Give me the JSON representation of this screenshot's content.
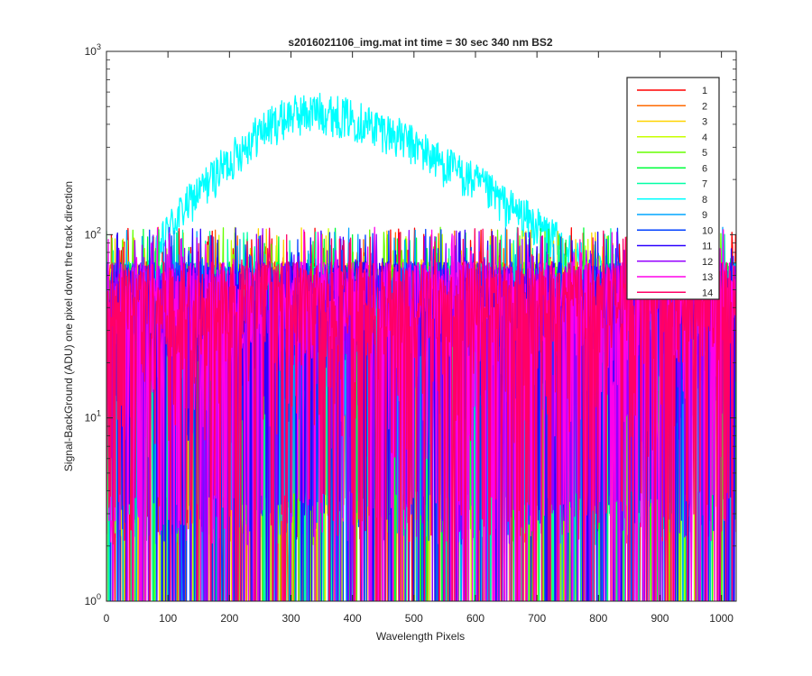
{
  "chart_data": {
    "type": "line",
    "title": "s2016021106_img.mat int time = 30 sec  340 nm BS2",
    "xlabel": "Wavelength Pixels",
    "ylabel": "Signal-BackGround (ADU) one pixel down the track direction",
    "xlim": [
      0,
      1024
    ],
    "ylim": [
      1,
      1000
    ],
    "yscale": "log",
    "grid": false,
    "legend_position": "top-right",
    "x_ticks": [
      "0",
      "100",
      "200",
      "300",
      "400",
      "500",
      "600",
      "700",
      "800",
      "900",
      "1000"
    ],
    "y_ticks": [
      {
        "base": "10",
        "exp": "0"
      },
      {
        "base": "10",
        "exp": "1"
      },
      {
        "base": "10",
        "exp": "2"
      },
      {
        "base": "10",
        "exp": "3"
      }
    ],
    "noise_band": {
      "typical_range_adu": [
        2,
        100
      ],
      "dropouts_to_adu": 1
    },
    "series": [
      {
        "name": "1",
        "color": "#ff0000",
        "profile": "noise",
        "level_adu": 30
      },
      {
        "name": "2",
        "color": "#ff6a00",
        "profile": "noise",
        "level_adu": 30
      },
      {
        "name": "3",
        "color": "#ffd400",
        "profile": "noise",
        "level_adu": 30
      },
      {
        "name": "4",
        "color": "#c8ff00",
        "profile": "noise",
        "level_adu": 30
      },
      {
        "name": "5",
        "color": "#66ff00",
        "profile": "noise",
        "level_adu": 30
      },
      {
        "name": "6",
        "color": "#00ff3c",
        "profile": "noise",
        "level_adu": 30
      },
      {
        "name": "7",
        "color": "#00ffa5",
        "profile": "noise",
        "level_adu": 30
      },
      {
        "name": "8",
        "color": "#00ffff",
        "profile": "peak",
        "envelope": [
          [
            0,
            40
          ],
          [
            30,
            60
          ],
          [
            50,
            40
          ],
          [
            75,
            70
          ],
          [
            100,
            110
          ],
          [
            150,
            175
          ],
          [
            200,
            260
          ],
          [
            250,
            380
          ],
          [
            300,
            470
          ],
          [
            350,
            490
          ],
          [
            400,
            450
          ],
          [
            450,
            390
          ],
          [
            500,
            320
          ],
          [
            550,
            250
          ],
          [
            600,
            200
          ],
          [
            650,
            150
          ],
          [
            700,
            115
          ],
          [
            750,
            85
          ],
          [
            800,
            65
          ],
          [
            850,
            55
          ],
          [
            900,
            45
          ],
          [
            950,
            40
          ],
          [
            1000,
            35
          ],
          [
            1024,
            30
          ]
        ]
      },
      {
        "name": "9",
        "color": "#00a5ff",
        "profile": "noise",
        "level_adu": 30
      },
      {
        "name": "10",
        "color": "#0040ff",
        "profile": "noise",
        "level_adu": 30
      },
      {
        "name": "11",
        "color": "#2a00ff",
        "profile": "noise",
        "level_adu": 30
      },
      {
        "name": "12",
        "color": "#9500ff",
        "profile": "noise",
        "level_adu": 30
      },
      {
        "name": "13",
        "color": "#ff00ea",
        "profile": "noise",
        "level_adu": 30
      },
      {
        "name": "14",
        "color": "#ff0066",
        "profile": "noise",
        "level_adu": 30
      }
    ]
  }
}
